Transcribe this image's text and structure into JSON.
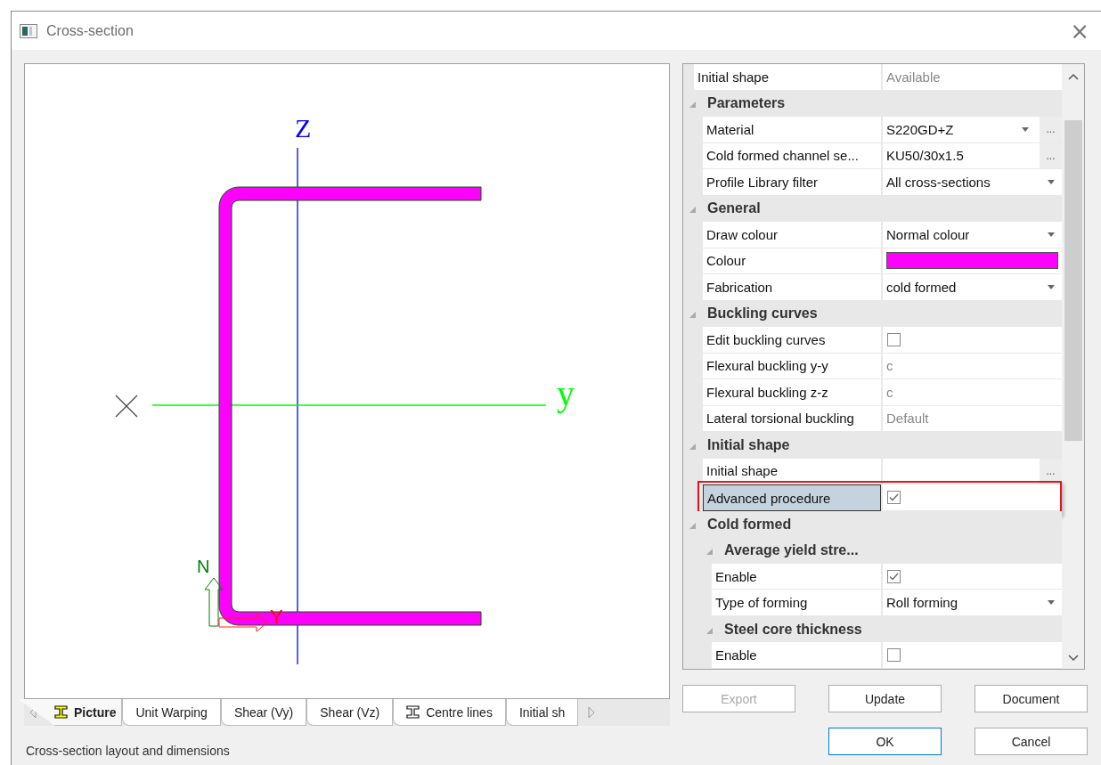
{
  "window": {
    "title": "Cross-section",
    "close": "×"
  },
  "canvas": {
    "axis_labels": [
      {
        "kind": "z",
        "text": "Z"
      },
      {
        "kind": "y",
        "text": "y"
      },
      {
        "kind": "local-n",
        "text": "N"
      },
      {
        "kind": "local-y",
        "text": "Y"
      }
    ]
  },
  "tabs": [
    {
      "label": "Picture",
      "kind": "with-icon",
      "selected": true
    },
    {
      "label": "Unit Warping",
      "kind": "plain",
      "selected": false
    },
    {
      "label": "Shear (Vy)",
      "kind": "plain",
      "selected": false
    },
    {
      "label": "Shear (Vz)",
      "kind": "plain",
      "selected": false
    },
    {
      "label": "Centre lines",
      "kind": "with-icon",
      "selected": false
    },
    {
      "label": "Initial sh",
      "kind": "plain",
      "selected": false
    }
  ],
  "status_bar": "Cross-section layout and dimensions",
  "properties": [
    {
      "kind": "text",
      "label": "Initial shape",
      "value": "Available",
      "disabled": true,
      "selected": false
    },
    {
      "kind": "category",
      "label": "Parameters",
      "expanded": true,
      "children": [
        {
          "kind": "dropdown",
          "label": "Material",
          "value": "S220GD+Z",
          "browse": "...",
          "selected": false
        },
        {
          "kind": "text",
          "label": "Cold formed channel se...",
          "value": "KU50/30x1.5",
          "browse": "...",
          "disabled": false,
          "selected": false
        },
        {
          "kind": "dropdown",
          "label": "Profile Library filter",
          "value": "All cross-sections",
          "selected": false
        }
      ]
    },
    {
      "kind": "category",
      "label": "General",
      "expanded": true,
      "children": [
        {
          "kind": "dropdown",
          "label": "Draw colour",
          "value": "Normal colour",
          "selected": false
        },
        {
          "kind": "color",
          "label": "Colour",
          "color": "#ff00ff",
          "selected": false
        },
        {
          "kind": "dropdown",
          "label": "Fabrication",
          "value": "cold formed",
          "selected": false
        }
      ]
    },
    {
      "kind": "category",
      "label": "Buckling curves",
      "expanded": true,
      "children": [
        {
          "kind": "checkbox",
          "label": "Edit buckling curves",
          "checked": false,
          "selected": false
        },
        {
          "kind": "text",
          "label": "Flexural buckling y-y",
          "value": "c",
          "disabled": true,
          "selected": false
        },
        {
          "kind": "text",
          "label": "Flexural buckling z-z",
          "value": "c",
          "disabled": true,
          "selected": false
        },
        {
          "kind": "text",
          "label": "Lateral torsional buckling",
          "value": "Default",
          "disabled": true,
          "selected": false
        }
      ]
    },
    {
      "kind": "category",
      "label": "Initial shape",
      "expanded": true,
      "children": [
        {
          "kind": "text",
          "label": "Initial shape",
          "browse": "...",
          "selected": false
        },
        {
          "kind": "checkbox",
          "label": "Advanced procedure",
          "checked": true,
          "selected": true,
          "highlighted": true
        }
      ]
    },
    {
      "kind": "category",
      "label": "Cold formed",
      "expanded": true,
      "children": [
        {
          "kind": "category",
          "label": "Average yield stre...",
          "expanded": true,
          "children": [
            {
              "kind": "checkbox",
              "label": "Enable",
              "checked": true,
              "selected": false
            },
            {
              "kind": "dropdown",
              "label": "Type of forming",
              "value": "Roll forming",
              "selected": false
            }
          ]
        },
        {
          "kind": "category",
          "label": "Steel core thickness",
          "expanded": true,
          "children": [
            {
              "kind": "checkbox",
              "label": "Enable",
              "checked": false,
              "selected": false
            }
          ]
        }
      ]
    }
  ],
  "buttons": [
    {
      "label": "Export",
      "disabled": true,
      "default": false
    },
    {
      "label": "Update",
      "disabled": false,
      "default": false
    },
    {
      "label": "Document",
      "disabled": false,
      "default": false
    },
    {
      "label": "OK",
      "disabled": false,
      "default": true
    },
    {
      "label": "Cancel",
      "disabled": false,
      "default": false
    }
  ]
}
